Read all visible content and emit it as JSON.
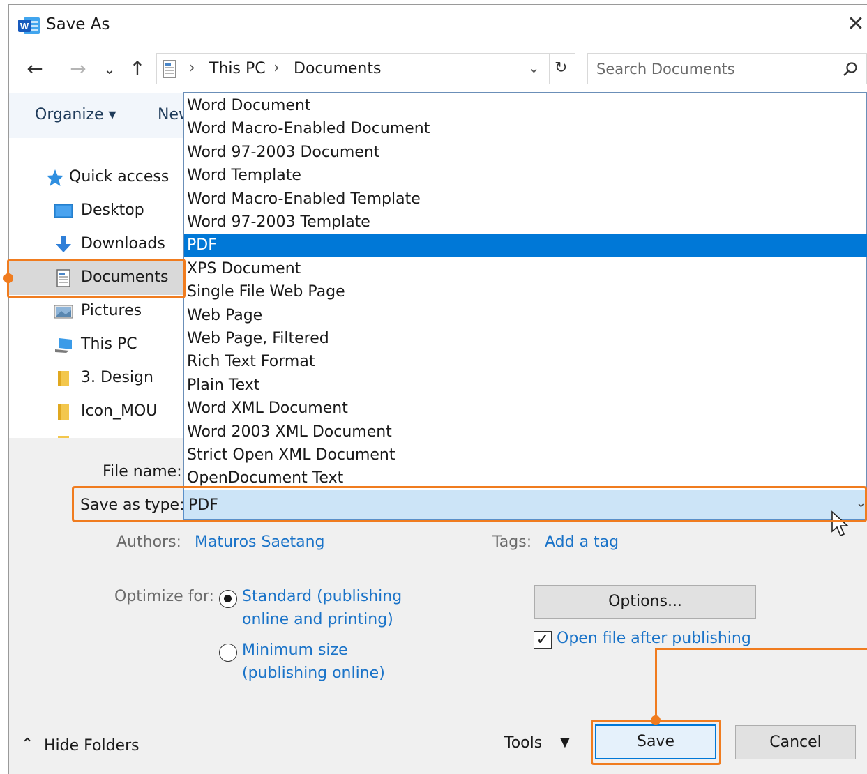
{
  "window": {
    "title": "Save As",
    "app_icon": "word-icon",
    "close_glyph": "✕"
  },
  "nav": {
    "back_glyph": "←",
    "forward_glyph": "→",
    "recent_glyph": "⌄",
    "up_glyph": "↑"
  },
  "address": {
    "crumbs": [
      "This PC",
      "Documents"
    ],
    "separator": "›",
    "dropdown_glyph": "⌄",
    "refresh_glyph": "↻"
  },
  "search": {
    "placeholder": "Search Documents",
    "value": ""
  },
  "toolbar": {
    "organize_label": "Organize ▾",
    "new_folder_label": "New folder"
  },
  "sidebar": {
    "items": [
      {
        "label": "Quick access",
        "icon": "star-icon"
      },
      {
        "label": "Desktop",
        "icon": "desktop-icon"
      },
      {
        "label": "Downloads",
        "icon": "download-arrow-icon"
      },
      {
        "label": "Documents",
        "icon": "documents-icon",
        "selected": true
      },
      {
        "label": "Pictures",
        "icon": "pictures-icon"
      },
      {
        "label": "This PC",
        "icon": "computer-icon"
      },
      {
        "label": "3. Design",
        "icon": "folder-icon"
      },
      {
        "label": "Icon_MOU",
        "icon": "folder-icon"
      }
    ]
  },
  "file_types": [
    "Word Document",
    "Word Macro-Enabled Document",
    "Word 97-2003 Document",
    "Word Template",
    "Word Macro-Enabled Template",
    "Word 97-2003 Template",
    "PDF",
    "XPS Document",
    "Single File Web Page",
    "Web Page",
    "Web Page, Filtered",
    "Rich Text Format",
    "Plain Text",
    "Word XML Document",
    "Word 2003 XML Document",
    "Strict Open XML Document",
    "OpenDocument Text"
  ],
  "selected_file_type": "PDF",
  "form": {
    "file_name_label": "File name:",
    "save_as_type_label": "Save as type:",
    "save_as_type_value": "PDF",
    "authors_label": "Authors:",
    "authors_value": "Maturos Saetang",
    "tags_label": "Tags:",
    "tags_value": "Add a tag",
    "optimize_label": "Optimize for:",
    "optimize_options": [
      {
        "line1": "Standard (publishing",
        "line2": "online and printing)",
        "checked": true
      },
      {
        "line1": "Minimum size",
        "line2": "(publishing online)",
        "checked": false
      }
    ],
    "options_button": "Options...",
    "open_after_label": "Open file after publishing",
    "open_after_checked": true
  },
  "footer": {
    "hide_folders_label": "Hide Folders",
    "hide_folders_glyph": "⌃",
    "tools_label": "Tools",
    "tools_glyph": "▼",
    "save_label": "Save",
    "cancel_label": "Cancel"
  },
  "colors": {
    "accent": "#0078d7",
    "annotation": "#f07c1f",
    "link": "#1a73c8",
    "select_highlight": "#cce4f7"
  }
}
